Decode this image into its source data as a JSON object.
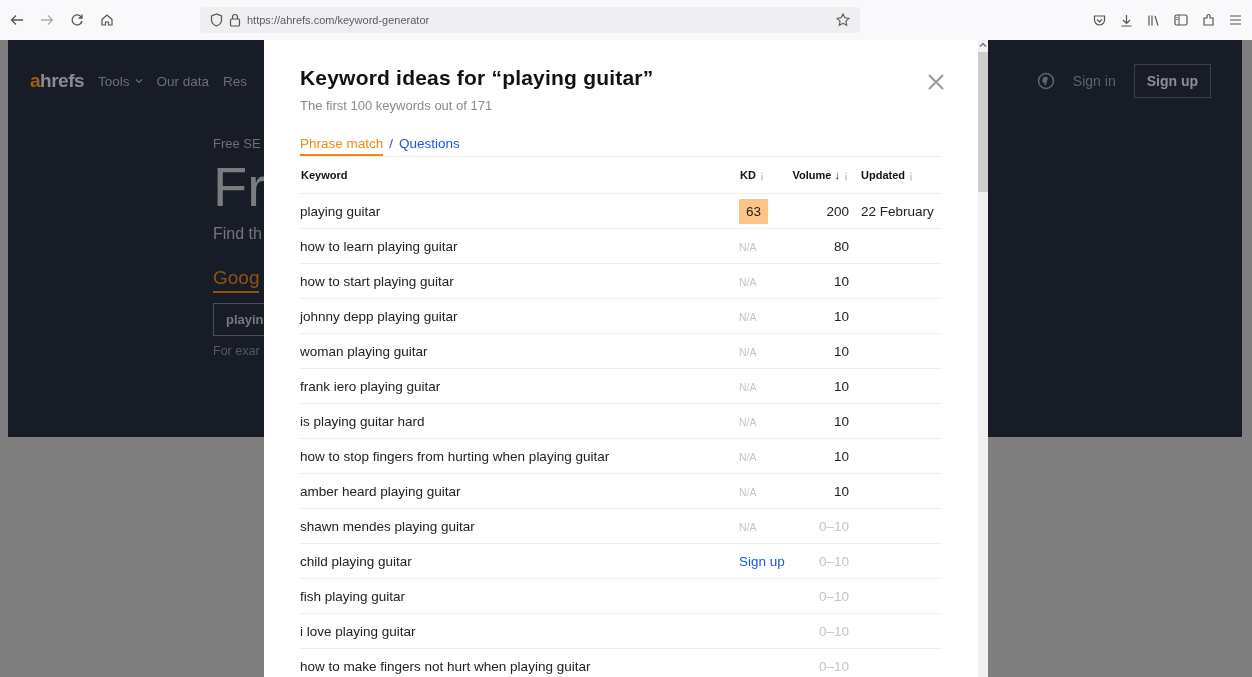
{
  "browser": {
    "url": "https://ahrefs.com/keyword-generator"
  },
  "site": {
    "logo": {
      "accent": "a",
      "rest": "hrefs"
    },
    "nav": [
      {
        "label": "Tools",
        "dropdown": true
      },
      {
        "label": "Our data",
        "dropdown": false
      },
      {
        "label": "Res",
        "dropdown": false
      }
    ],
    "eyebrow": "Free SE",
    "headline": "Fr",
    "lead": "Find th",
    "engine_tab": "Goog",
    "search": {
      "value": "playin"
    },
    "example": "For exar",
    "sign_in": "Sign in",
    "sign_up": "Sign up"
  },
  "modal": {
    "title": "Keyword ideas for “playing guitar”",
    "subtitle": "The first 100 keywords out of 171",
    "tabs": [
      {
        "label": "Phrase match",
        "selected": true
      },
      {
        "label": "Questions",
        "selected": false
      }
    ],
    "separator": "/",
    "columns": [
      {
        "label": "Keyword",
        "info": false
      },
      {
        "label": "KD",
        "info": true
      },
      {
        "label": "Volume ↓",
        "info": true
      },
      {
        "label": "Updated",
        "info": true
      }
    ],
    "rows": [
      {
        "keyword": "playing guitar",
        "kd": {
          "kind": "score",
          "text": "63"
        },
        "volume": {
          "kind": "exact",
          "text": "200"
        },
        "updated": "22 February"
      },
      {
        "keyword": "how to learn playing guitar",
        "kd": {
          "kind": "na",
          "text": "N/A"
        },
        "volume": {
          "kind": "exact",
          "text": "80"
        }
      },
      {
        "keyword": "how to start playing guitar",
        "kd": {
          "kind": "na",
          "text": "N/A"
        },
        "volume": {
          "kind": "exact",
          "text": "10"
        }
      },
      {
        "keyword": "johnny depp playing guitar",
        "kd": {
          "kind": "na",
          "text": "N/A"
        },
        "volume": {
          "kind": "exact",
          "text": "10"
        }
      },
      {
        "keyword": "woman playing guitar",
        "kd": {
          "kind": "na",
          "text": "N/A"
        },
        "volume": {
          "kind": "exact",
          "text": "10"
        }
      },
      {
        "keyword": "frank iero playing guitar",
        "kd": {
          "kind": "na",
          "text": "N/A"
        },
        "volume": {
          "kind": "exact",
          "text": "10"
        }
      },
      {
        "keyword": "is playing guitar hard",
        "kd": {
          "kind": "na",
          "text": "N/A"
        },
        "volume": {
          "kind": "exact",
          "text": "10"
        }
      },
      {
        "keyword": "how to stop fingers from hurting when playing guitar",
        "kd": {
          "kind": "na",
          "text": "N/A"
        },
        "volume": {
          "kind": "exact",
          "text": "10"
        }
      },
      {
        "keyword": "amber heard playing guitar",
        "kd": {
          "kind": "na",
          "text": "N/A"
        },
        "volume": {
          "kind": "exact",
          "text": "10"
        }
      },
      {
        "keyword": "shawn mendes playing guitar",
        "kd": {
          "kind": "na",
          "text": "N/A"
        },
        "volume": {
          "kind": "range",
          "text": "0–10"
        }
      },
      {
        "keyword": "child playing guitar",
        "kd": {
          "kind": "signup",
          "text": "Sign up"
        },
        "volume": {
          "kind": "range",
          "text": "0–10"
        }
      },
      {
        "keyword": "fish playing guitar",
        "volume": {
          "kind": "range",
          "text": "0–10"
        }
      },
      {
        "keyword": "i love playing guitar",
        "volume": {
          "kind": "range",
          "text": "0–10"
        }
      },
      {
        "keyword": "how to make fingers not hurt when playing guitar",
        "volume": {
          "kind": "range",
          "text": "0–10"
        }
      }
    ]
  }
}
